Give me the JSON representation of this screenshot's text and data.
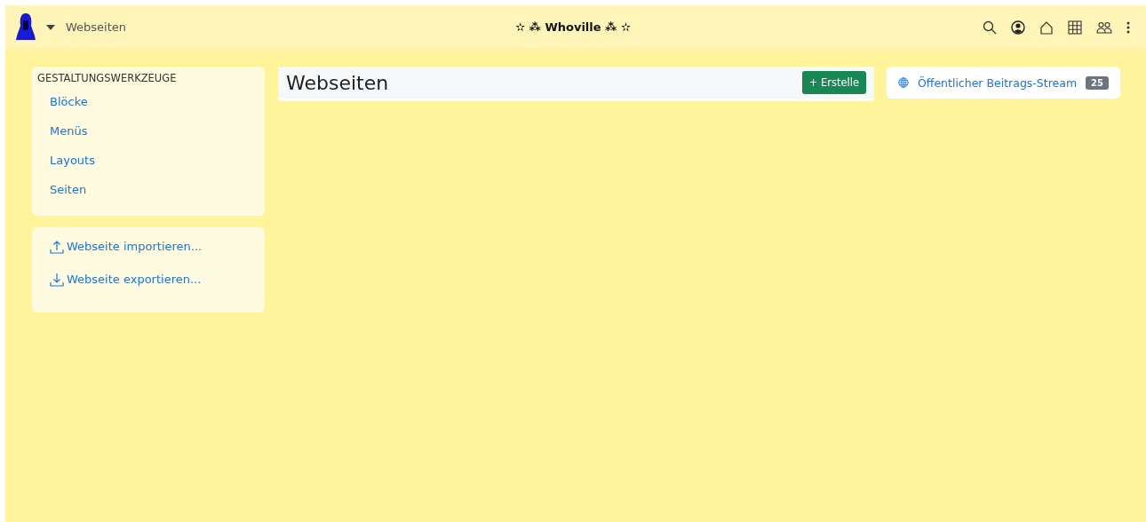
{
  "navbar": {
    "page_title": "Webseiten",
    "site_name": "✫ ⁂ Whoville ⁂ ✫"
  },
  "sidebar": {
    "heading": "GESTALTUNGSWERKZEUGE",
    "items": [
      {
        "label": "Blöcke"
      },
      {
        "label": "Menüs"
      },
      {
        "label": "Layouts"
      },
      {
        "label": "Seiten"
      }
    ],
    "actions": [
      {
        "kind": "import",
        "label": "Webseite importieren..."
      },
      {
        "kind": "export",
        "label": "Webseite exportieren..."
      }
    ]
  },
  "main": {
    "title": "Webseiten",
    "create_button": "+ Erstelle"
  },
  "stream": {
    "label": "Öffentlicher Beitrags-Stream",
    "count": "25"
  }
}
